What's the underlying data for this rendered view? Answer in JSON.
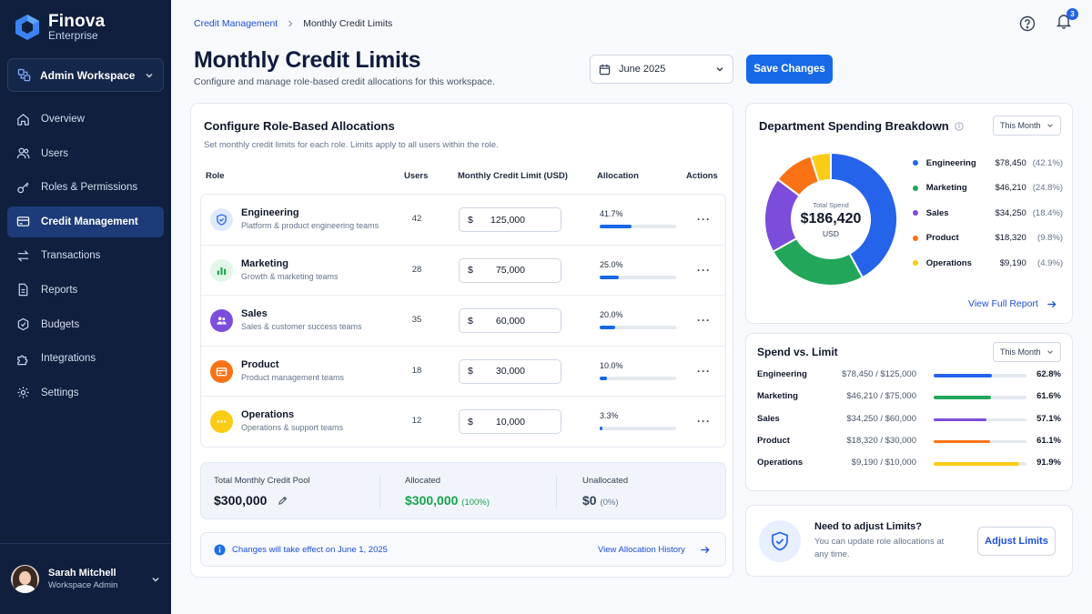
{
  "brand": {
    "name": "Finova",
    "sub": "Enterprise"
  },
  "workspace": {
    "label": "Admin Workspace"
  },
  "nav": [
    {
      "label": "Overview",
      "icon": "home-icon"
    },
    {
      "label": "Users",
      "icon": "users-icon"
    },
    {
      "label": "Roles & Permissions",
      "icon": "key-icon"
    },
    {
      "label": "Credit Management",
      "icon": "credit-card-icon",
      "active": true
    },
    {
      "label": "Transactions",
      "icon": "swap-icon"
    },
    {
      "label": "Reports",
      "icon": "document-icon"
    },
    {
      "label": "Budgets",
      "icon": "target-icon"
    },
    {
      "label": "Integrations",
      "icon": "puzzle-icon"
    },
    {
      "label": "Settings",
      "icon": "gear-icon"
    }
  ],
  "user": {
    "name": "Sarah Mitchell",
    "role": "Workspace Admin"
  },
  "breadcrumb": {
    "parent": "Credit Management",
    "current": "Monthly Credit Limits"
  },
  "notifications": {
    "count": "3"
  },
  "header": {
    "title": "Monthly Credit Limits",
    "subtitle": "Configure and manage role-based credit allocations for this workspace.",
    "date": "June 2025",
    "save_label": "Save Changes"
  },
  "allocations": {
    "title": "Configure Role-Based Allocations",
    "subtitle": "Set monthly credit limits for each role. Limits apply to all users within the role.",
    "columns": {
      "role": "Role",
      "users": "Users",
      "limit": "Monthly Credit Limit (USD)",
      "allocation": "Allocation",
      "actions": "Actions"
    },
    "currency_symbol": "$",
    "rows": [
      {
        "name": "Engineering",
        "desc": "Platform & product engineering teams",
        "users": "42",
        "limit": "125,000",
        "pct_label": "41.7%",
        "pct": 41.7,
        "color": "#2563eb",
        "bg": "#e0eaff",
        "icon": "shield-icon"
      },
      {
        "name": "Marketing",
        "desc": "Growth & marketing teams",
        "users": "28",
        "limit": "75,000",
        "pct_label": "25.0%",
        "pct": 25.0,
        "color": "#16a34a",
        "bg": "#e2f6ea",
        "icon": "bar-chart-icon"
      },
      {
        "name": "Sales",
        "desc": "Sales & customer success teams",
        "users": "35",
        "limit": "60,000",
        "pct_label": "20.0%",
        "pct": 20.0,
        "color": "#7c3aed",
        "bg": "#eee5ff",
        "icon": "people-icon"
      },
      {
        "name": "Product",
        "desc": "Product management teams",
        "users": "18",
        "limit": "30,000",
        "pct_label": "10.0%",
        "pct": 10.0,
        "color": "#f97316",
        "bg": "#ffedd5",
        "icon": "wallet-icon"
      },
      {
        "name": "Operations",
        "desc": "Operations & support teams",
        "users": "12",
        "limit": "10,000",
        "pct_label": "3.3%",
        "pct": 3.3,
        "color": "#eab308",
        "bg": "#fdf3c7",
        "icon": "more-icon"
      }
    ],
    "pool": {
      "total_label": "Total Monthly Credit Pool",
      "total_value": "$300,000",
      "allocated_label": "Allocated",
      "allocated_value": "$300,000",
      "allocated_pct": "(100%)",
      "unallocated_label": "Unallocated",
      "unallocated_value": "$0",
      "unallocated_pct": "(0%)"
    },
    "notice": {
      "text": "Changes will take effect on June 1, 2025",
      "link": "View Allocation History"
    }
  },
  "breakdown": {
    "title": "Department Spending Breakdown",
    "period": "This Month",
    "total_label": "Total Spend",
    "total_value": "$186,420",
    "total_unit": "USD",
    "link": "View Full Report"
  },
  "chart_data": {
    "type": "pie",
    "categories": [
      "Engineering",
      "Marketing",
      "Sales",
      "Product",
      "Operations"
    ],
    "values": [
      78450,
      46210,
      34250,
      18320,
      9190
    ],
    "amounts": [
      "$78,450",
      "$46,210",
      "$34,250",
      "$18,320",
      "$9,190"
    ],
    "percents": [
      "(42.1%)",
      "(24.8%)",
      "(18.4%)",
      "(9.8%)",
      "(4.9%)"
    ],
    "percent_values": [
      42.1,
      24.8,
      18.4,
      9.8,
      4.9
    ],
    "colors": [
      "#2563eb",
      "#22a75a",
      "#7c4ddb",
      "#f97316",
      "#facc15"
    ],
    "legend_position": "right"
  },
  "spend_vs_limit": {
    "title": "Spend vs. Limit",
    "period": "This Month",
    "rows": [
      {
        "name": "Engineering",
        "amount": "$78,450 / $125,000",
        "pct_label": "62.8%",
        "pct": 62.8,
        "color": "#2563eb"
      },
      {
        "name": "Marketing",
        "amount": "$46,210 / $75,000",
        "pct_label": "61.6%",
        "pct": 61.6,
        "color": "#22a75a"
      },
      {
        "name": "Sales",
        "amount": "$34,250 / $60,000",
        "pct_label": "57.1%",
        "pct": 57.1,
        "color": "#7c4ddb"
      },
      {
        "name": "Product",
        "amount": "$18,320 / $30,000",
        "pct_label": "61.1%",
        "pct": 61.1,
        "color": "#f97316"
      },
      {
        "name": "Operations",
        "amount": "$9,190 / $10,000",
        "pct_label": "91.9%",
        "pct": 91.9,
        "color": "#facc15"
      }
    ]
  },
  "help": {
    "title": "Need to adjust Limits?",
    "text": "You can update role allocations at any time.",
    "button": "Adjust Limits"
  }
}
